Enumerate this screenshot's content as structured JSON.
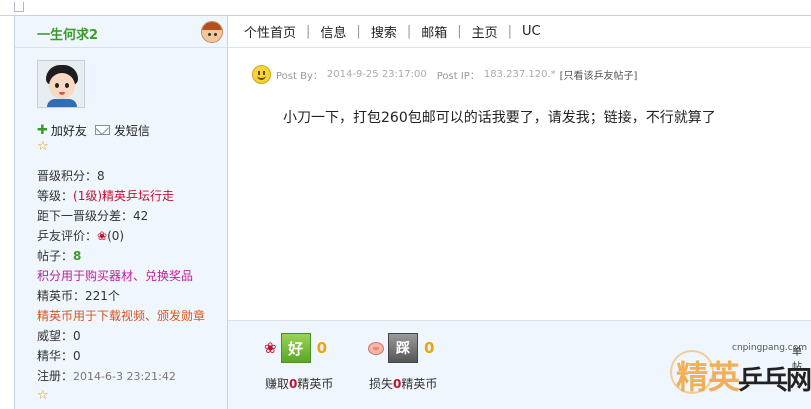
{
  "sidebar": {
    "username": "一生何求2",
    "add_friend": "加好友",
    "send_message": "发短信",
    "stats": [
      {
        "label": "晋级积分：",
        "value": "8"
      },
      {
        "label": "等级：",
        "value": "(1级)精英乒坛行走"
      },
      {
        "label": "距下一晋级分差：",
        "value": "42"
      },
      {
        "label": "乒友评价：",
        "value": "(0)"
      },
      {
        "label": "帖子：",
        "value": "8"
      },
      {
        "label": "积分用于购买器材、兑换奖品",
        "value": ""
      },
      {
        "label": "精英币：",
        "value": "221个"
      },
      {
        "label": "精英币用于下载视频、颁发勋章",
        "value": ""
      },
      {
        "label": "威望：",
        "value": "0"
      },
      {
        "label": "精华：",
        "value": "0"
      },
      {
        "label": "注册：",
        "value": "2014-6-3 23:21:42"
      }
    ]
  },
  "nav": {
    "items": [
      "个性首页",
      "信息",
      "搜索",
      "邮箱",
      "主页",
      "UC"
    ]
  },
  "post": {
    "by_label": "Post By：",
    "by_value": "2014-9-25 23:17:00",
    "ip_label": "Post IP：",
    "ip_value": "183.237.120.*",
    "only_link": "[只看该乒友帖子]",
    "content": "小刀一下，打包260包邮可以的话我要了，请发我；链接，不行就算了"
  },
  "rating": {
    "good_label": "好",
    "good_count": "0",
    "bad_label": "踩",
    "bad_count": "0",
    "earn_prefix": "赚取",
    "earn_value": "0",
    "earn_suffix": "精英币",
    "lose_prefix": "损失",
    "lose_value": "0",
    "lose_suffix": "精英币"
  },
  "watermark": {
    "url": "cnpingpang.com",
    "brand_a": "精英",
    "brand_b": "乒乓网",
    "cut_text": "单帖"
  },
  "colors": {
    "sidebar_bg": "#f0f6fd",
    "username_green": "#3a9b2b",
    "level_red": "#c8102e",
    "points_magenta": "#c0209a",
    "coins_orange": "#d8561a",
    "count_orange": "#f0a20c"
  }
}
